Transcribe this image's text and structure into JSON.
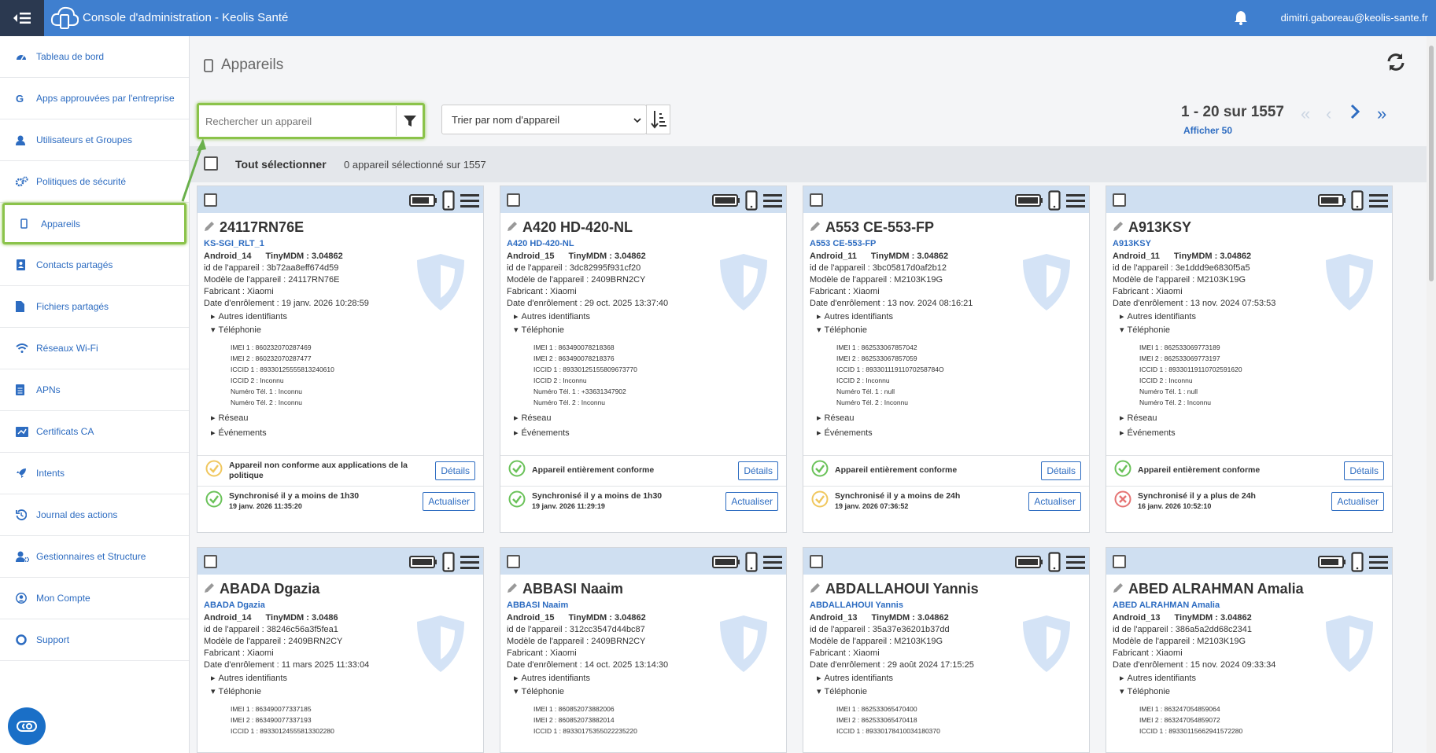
{
  "header": {
    "menu_icon": "menu-collapse-icon",
    "logo_icon": "cloud-device-icon",
    "title": "Console d'administration - Keolis Santé",
    "notification_icon": "bell-icon",
    "user": "dimitri.gaboreau@keolis-sante.fr"
  },
  "sidebar": {
    "items": [
      {
        "label": "Tableau de bord",
        "icon": "dashboard-icon"
      },
      {
        "label": "Apps approuvées par l'entreprise",
        "icon": "google-icon"
      },
      {
        "label": "Utilisateurs et Groupes",
        "icon": "user-icon"
      },
      {
        "label": "Politiques de sécurité",
        "icon": "gears-icon"
      },
      {
        "label": "Appareils",
        "icon": "mobile-icon",
        "active": true
      },
      {
        "label": "Contacts partagés",
        "icon": "contact-book-icon"
      },
      {
        "label": "Fichiers partagés",
        "icon": "file-icon"
      },
      {
        "label": "Réseaux Wi-Fi",
        "icon": "wifi-icon"
      },
      {
        "label": "APNs",
        "icon": "document-icon"
      },
      {
        "label": "Certificats CA",
        "icon": "certificate-icon"
      },
      {
        "label": "Intents",
        "icon": "rocket-icon"
      },
      {
        "label": "Journal des actions",
        "icon": "history-icon"
      },
      {
        "label": "Gestionnaires et Structure",
        "icon": "user-gear-icon"
      },
      {
        "label": "Mon Compte",
        "icon": "user-circle-icon"
      },
      {
        "label": "Support",
        "icon": "lifebuoy-icon"
      }
    ]
  },
  "main": {
    "title": "Appareils",
    "search_placeholder": "Rechercher un appareil",
    "sort_label": "Trier par nom d'appareil",
    "pagination": "1 - 20 sur 1557",
    "show_more": "Afficher 50",
    "select_all": "Tout sélectionner",
    "selected_count": "0 appareil sélectionné sur 1557"
  },
  "cards": [
    {
      "name": "24117RN76E",
      "sub": "KS-SGI_RLT_1",
      "android": "Android_14",
      "mdm": "TinyMDM : 3.04862",
      "id": "id de l'appareil : 3b72aa8eff674d59",
      "model": "Modèle de l'appareil : 24117RN76E",
      "maker": "Fabricant : Xiaomi",
      "enrol": "Date d'enrôlement : 19 janv. 2026 10:28:59",
      "other": "Autres identifiants",
      "tel": "Téléphonie",
      "imei1": "IMEI 1 : 860232070287469",
      "imei2": "IMEI 2 : 860232070287477",
      "iccid1": "ICCID 1 : 89330125555813240610",
      "iccid2": "ICCID 2 : Inconnu",
      "num1": "Numéro Tél. 1 : Inconnu",
      "num2": "Numéro Tél. 2 : Inconnu",
      "net": "Réseau",
      "events": "Événements",
      "c_status": "Appareil non conforme aux applications de la politique",
      "c_color": "#f0c75e",
      "details": "Détails",
      "s_status": "Synchronisé il y a moins de 1h30",
      "s_date": "19 janv. 2026 11:35:20",
      "s_color": "#6ac259",
      "refresh": "Actualiser"
    },
    {
      "name": "A420 HD-420-NL",
      "sub": "A420 HD-420-NL",
      "android": "Android_15",
      "mdm": "TinyMDM : 3.04862",
      "id": "id de l'appareil : 3dc82995f931cf20",
      "model": "Modèle de l'appareil : 2409BRN2CY",
      "maker": "Fabricant : Xiaomi",
      "enrol": "Date d'enrôlement : 29 oct. 2025 13:37:40",
      "other": "Autres identifiants",
      "tel": "Téléphonie",
      "imei1": "IMEI 1 : 863490078218368",
      "imei2": "IMEI 2 : 863490078218376",
      "iccid1": "ICCID 1 : 89330125155809673770",
      "iccid2": "ICCID 2 : Inconnu",
      "num1": "Numéro Tél. 1 : +33631347902",
      "num2": "Numéro Tél. 2 : Inconnu",
      "net": "Réseau",
      "events": "Événements",
      "c_status": "Appareil entièrement conforme",
      "c_color": "#6ac259",
      "details": "Détails",
      "s_status": "Synchronisé il y a moins de 1h30",
      "s_date": "19 janv. 2026 11:29:19",
      "s_color": "#6ac259",
      "refresh": "Actualiser"
    },
    {
      "name": "A553 CE-553-FP",
      "sub": "A553 CE-553-FP",
      "android": "Android_11",
      "mdm": "TinyMDM : 3.04862",
      "id": "id de l'appareil : 3bc05817d0af2b12",
      "model": "Modèle de l'appareil : M2103K19G",
      "maker": "Fabricant : Xiaomi",
      "enrol": "Date d'enrôlement : 13 nov. 2024 08:16:21",
      "other": "Autres identifiants",
      "tel": "Téléphonie",
      "imei1": "IMEI 1 : 862533067857042",
      "imei2": "IMEI 2 : 862533067857059",
      "iccid1": "ICCID 1 : 89330111911070258784O",
      "iccid2": "ICCID 2 : Inconnu",
      "num1": "Numéro Tél. 1 : null",
      "num2": "Numéro Tél. 2 : Inconnu",
      "net": "Réseau",
      "events": "Événements",
      "c_status": "Appareil entièrement conforme",
      "c_color": "#6ac259",
      "details": "Détails",
      "s_status": "Synchronisé il y a moins de 24h",
      "s_date": "19 janv. 2026 07:36:52",
      "s_color": "#f0c75e",
      "refresh": "Actualiser"
    },
    {
      "name": "A913KSY",
      "sub": "A913KSY",
      "android": "Android_11",
      "mdm": "TinyMDM : 3.04862",
      "id": "id de l'appareil : 3e1ddd9e6830f5a5",
      "model": "Modèle de l'appareil : M2103K19G",
      "maker": "Fabricant : Xiaomi",
      "enrol": "Date d'enrôlement : 13 nov. 2024 07:53:53",
      "other": "Autres identifiants",
      "tel": "Téléphonie",
      "imei1": "IMEI 1 : 862533069773189",
      "imei2": "IMEI 2 : 862533069773197",
      "iccid1": "ICCID 1 : 89330119110702591620",
      "iccid2": "ICCID 2 : Inconnu",
      "num1": "Numéro Tél. 1 : null",
      "num2": "Numéro Tél. 2 : Inconnu",
      "net": "Réseau",
      "events": "Événements",
      "c_status": "Appareil entièrement conforme",
      "c_color": "#6ac259",
      "details": "Détails",
      "s_status": "Synchronisé il y a plus de 24h",
      "s_date": "16 janv. 2026 10:52:10",
      "s_color": "#e57373",
      "refresh": "Actualiser"
    },
    {
      "name": "ABADA Dgazia",
      "sub": "ABADA Dgazia",
      "android": "Android_14",
      "mdm": "TinyMDM : 3.0486",
      "id": "id de l'appareil : 38246c56a3f5fea1",
      "model": "Modèle de l'appareil : 2409BRN2CY",
      "maker": "Fabricant : Xiaomi",
      "enrol": "Date d'enrôlement : 11 mars 2025 11:33:04",
      "other": "Autres identifiants",
      "tel": "Téléphonie",
      "imei1": "IMEI 1 : 863490077337185",
      "imei2": "IMEI 2 : 863490077337193",
      "iccid1": "ICCID 1 : 89330124555813302280"
    },
    {
      "name": "ABBASI Naaim",
      "sub": "ABBASI Naaim",
      "android": "Android_15",
      "mdm": "TinyMDM : 3.04862",
      "id": "id de l'appareil : 312cc3547d44bc87",
      "model": "Modèle de l'appareil : 2409BRN2CY",
      "maker": "Fabricant : Xiaomi",
      "enrol": "Date d'enrôlement : 14 oct. 2025 13:14:30",
      "other": "Autres identifiants",
      "tel": "Téléphonie",
      "imei1": "IMEI 1 : 860852073882006",
      "imei2": "IMEI 2 : 860852073882014",
      "iccid1": "ICCID 1 : 89330175355022235220"
    },
    {
      "name": "ABDALLAHOUI Yannis",
      "sub": "ABDALLAHOUI Yannis",
      "android": "Android_13",
      "mdm": "TinyMDM : 3.04862",
      "id": "id de l'appareil : 35a37e36201b37dd",
      "model": "Modèle de l'appareil : M2103K19G",
      "maker": "Fabricant : Xiaomi",
      "enrol": "Date d'enrôlement : 29 août 2024 17:15:25",
      "other": "Autres identifiants",
      "tel": "Téléphonie",
      "imei1": "IMEI 1 : 862533065470400",
      "imei2": "IMEI 2 : 862533065470418",
      "iccid1": "ICCID 1 : 89330178410034180370"
    },
    {
      "name": "ABED ALRAHMAN Amalia",
      "sub": "ABED ALRAHMAN Amalia",
      "android": "Android_13",
      "mdm": "TinyMDM : 3.04862",
      "id": "id de l'appareil : 386a5a2dd68c2341",
      "model": "Modèle de l'appareil : M2103K19G",
      "maker": "Fabricant : Xiaomi",
      "enrol": "Date d'enrôlement : 15 nov. 2024 09:33:34",
      "other": "Autres identifiants",
      "tel": "Téléphonie",
      "imei1": "IMEI 1 : 863247054859064",
      "imei2": "IMEI 2 : 863247054859072",
      "iccid1": "ICCID 1 : 89330115662941572280"
    }
  ]
}
